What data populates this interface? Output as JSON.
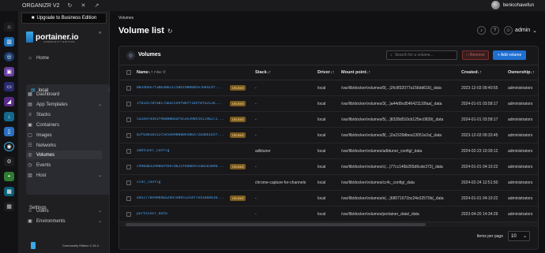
{
  "topbar": {
    "app_name": "ORGANIZR V2",
    "icons": [
      "refresh-icon",
      "close-icon",
      "external-link-icon"
    ],
    "username": "benicohavefun"
  },
  "sidebar": {
    "upgrade_label": "Upgrade to Business Edition",
    "logo_text": "portainer.io",
    "logo_sub": "COMMUNITY EDITION",
    "home_label": "Home",
    "environment_name": "local",
    "env_items": [
      {
        "label": "Dashboard",
        "icon": "dashboard-icon"
      },
      {
        "label": "App Templates",
        "icon": "templates-icon"
      },
      {
        "label": "Stacks",
        "icon": "stacks-icon"
      },
      {
        "label": "Containers",
        "icon": "containers-icon"
      },
      {
        "label": "Images",
        "icon": "images-icon"
      },
      {
        "label": "Networks",
        "icon": "networks-icon"
      },
      {
        "label": "Volumes",
        "icon": "volumes-icon"
      },
      {
        "label": "Events",
        "icon": "events-icon"
      },
      {
        "label": "Host",
        "icon": "host-icon"
      }
    ],
    "settings_heading": "Settings",
    "settings_items": [
      {
        "label": "Users",
        "icon": "users-icon"
      },
      {
        "label": "Environments",
        "icon": "environments-icon"
      }
    ],
    "footer_text": "Community Edition  2.16.4"
  },
  "main": {
    "breadcrumb": "Volumes",
    "title": "Volume list",
    "user_label": "admin",
    "card_title": "Volumes",
    "search_placeholder": "Search for a volume...",
    "remove_label": "Remove",
    "add_label": "+ Add volume",
    "columns": [
      "Name",
      "Filter",
      "Stack",
      "Driver",
      "Mount point",
      "Created",
      "Ownership"
    ],
    "rows": [
      {
        "name": "0034b6e7f306a0b21c50b190b005e768414f...",
        "unused": "Unused",
        "stack": "-",
        "driver": "local",
        "mount": "/var/lib/docker/volumes/0(...)2fc9f32077a156dd616(_data",
        "created": "2023-12-03 09:40:55",
        "owner": "administrators"
      },
      {
        "name": "1fb16570fa017a6ac5e9f06ff105f0fa3126...",
        "unused": "Unused",
        "stack": "-",
        "driver": "local",
        "mount": "/var/lib/docker/volumes/3(...)a44d9cd546421110faa(_data",
        "created": "2024-01-01 03:58:17",
        "owner": "administrators"
      },
      {
        "name": "5a3a974441f9680066af653e39055e2146272...",
        "unused": "Unused",
        "stack": "-",
        "driver": "local",
        "mount": "/var/lib/docker/volumes/5(...)8328d510cb125ec0839(_data",
        "created": "2024-01-01 03:58:17",
        "owner": "administrators"
      },
      {
        "name": "82f64018152c5e5eb90000e506e726ab61b5f...",
        "unused": "Unused",
        "stack": "-",
        "driver": "local",
        "mount": "/var/lib/docker/volumes/8(...)2a1539dbea13051e2a(_data",
        "created": "2023-12-03 09:33:45",
        "owner": "administrators"
      },
      {
        "name": "adbtuner_config",
        "unused": "",
        "stack": "adbtuner",
        "driver": "local",
        "mount": "/var/lib/docker/volumes/adbtuner_config/_data",
        "created": "2024-02-23 10:39:12",
        "owner": "administrators"
      },
      {
        "name": "c998d03299869fb97d625fbd0b915a0c6589b...",
        "unused": "Unused",
        "stack": "-",
        "driver": "local",
        "mount": "/var/lib/docker/volumes/c(...)77cc146b265d6cde372(_data",
        "created": "2024-01-01 04:10:22",
        "owner": "administrators"
      },
      {
        "name": "cc4c_config",
        "unused": "",
        "stack": "chrome-capture-for-channels",
        "driver": "local",
        "mount": "/var/lib/docker/volumes/cc4c_config/_data",
        "created": "2024-02-24 12:51:50",
        "owner": "administrators"
      },
      {
        "name": "ed52778e99bd6a29d7e0951254f7e41668436...",
        "unused": "Unused",
        "stack": "-",
        "driver": "local",
        "mount": "/var/lib/docker/volumes/e(...)68071671bc24e32570b(_data",
        "created": "2024-01-01 04:10:22",
        "owner": "administrators"
      },
      {
        "name": "portainer_data",
        "unused": "",
        "stack": "-",
        "driver": "local",
        "mount": "/var/lib/docker/volumes/portainer_data/_data",
        "created": "2023-04-20 14:34:29",
        "owner": "administrators"
      }
    ],
    "items_per_page_label": "Items per page",
    "items_per_page_value": "10"
  },
  "colors": {
    "accent": "#1f6fd1",
    "link": "#4aa3f0",
    "unused_badge": "#7a5a1c"
  }
}
